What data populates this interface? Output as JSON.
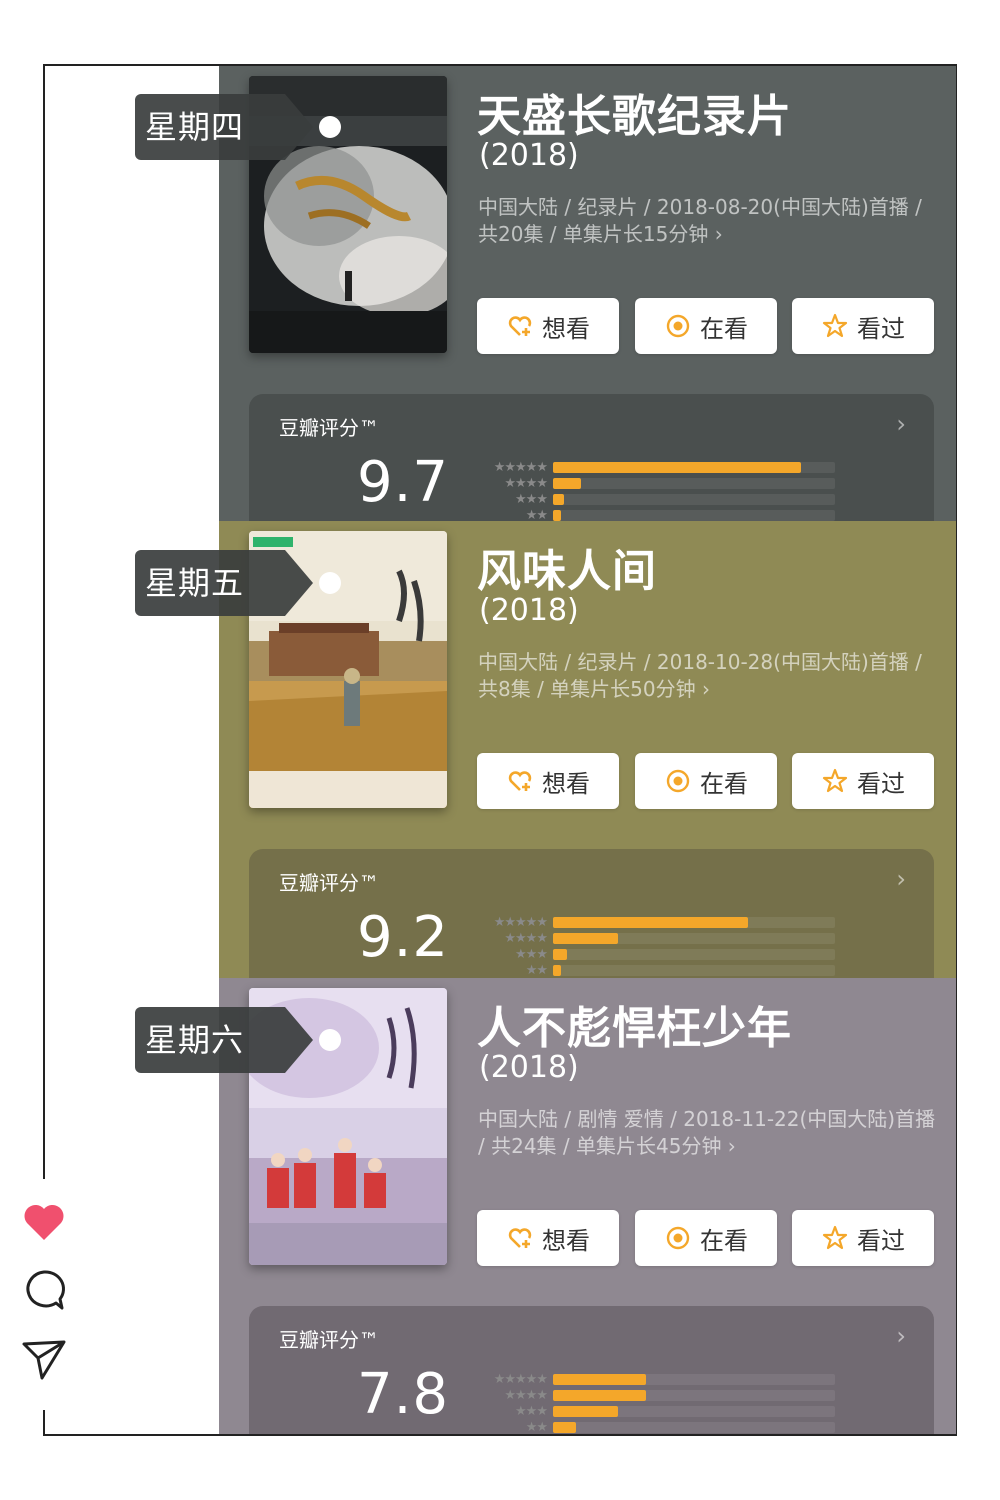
{
  "colors": {
    "card1_bg": "#5b6160",
    "card1_panel": "#4a4f4e",
    "card2_bg": "#8f8a55",
    "card2_panel": "#75704a",
    "card3_bg": "#8f8891",
    "card3_panel": "#716a72",
    "accent": "#f4a72a",
    "heart": "#f0506e"
  },
  "buttons": {
    "want": "想看",
    "watching": "在看",
    "watched": "看过"
  },
  "shows": [
    {
      "day": "星期四",
      "title": "天盛长歌纪录片",
      "year": "(2018)",
      "meta": "中国大陆 / 纪录片 / 2018-08-20(中国大陆)首播 / 共20集 / 单集片长15分钟 ›",
      "rating_label": "豆瓣评分™",
      "score": "9.7",
      "bars": [
        0.88,
        0.1,
        0.04,
        0.03
      ]
    },
    {
      "day": "星期五",
      "title": "风味人间",
      "year": "(2018)",
      "meta": "中国大陆 / 纪录片 / 2018-10-28(中国大陆)首播 / 共8集 / 单集片长50分钟 ›",
      "rating_label": "豆瓣评分™",
      "score": "9.2",
      "bars": [
        0.69,
        0.23,
        0.05,
        0.03
      ]
    },
    {
      "day": "星期六",
      "title": "人不彪悍枉少年",
      "year": "(2018)",
      "meta": "中国大陆 / 剧情 爱情 / 2018-11-22(中国大陆)首播 / 共24集 / 单集片长45分钟 ›",
      "rating_label": "豆瓣评分™",
      "score": "7.8",
      "bars": [
        0.33,
        0.33,
        0.23,
        0.08
      ]
    }
  ]
}
